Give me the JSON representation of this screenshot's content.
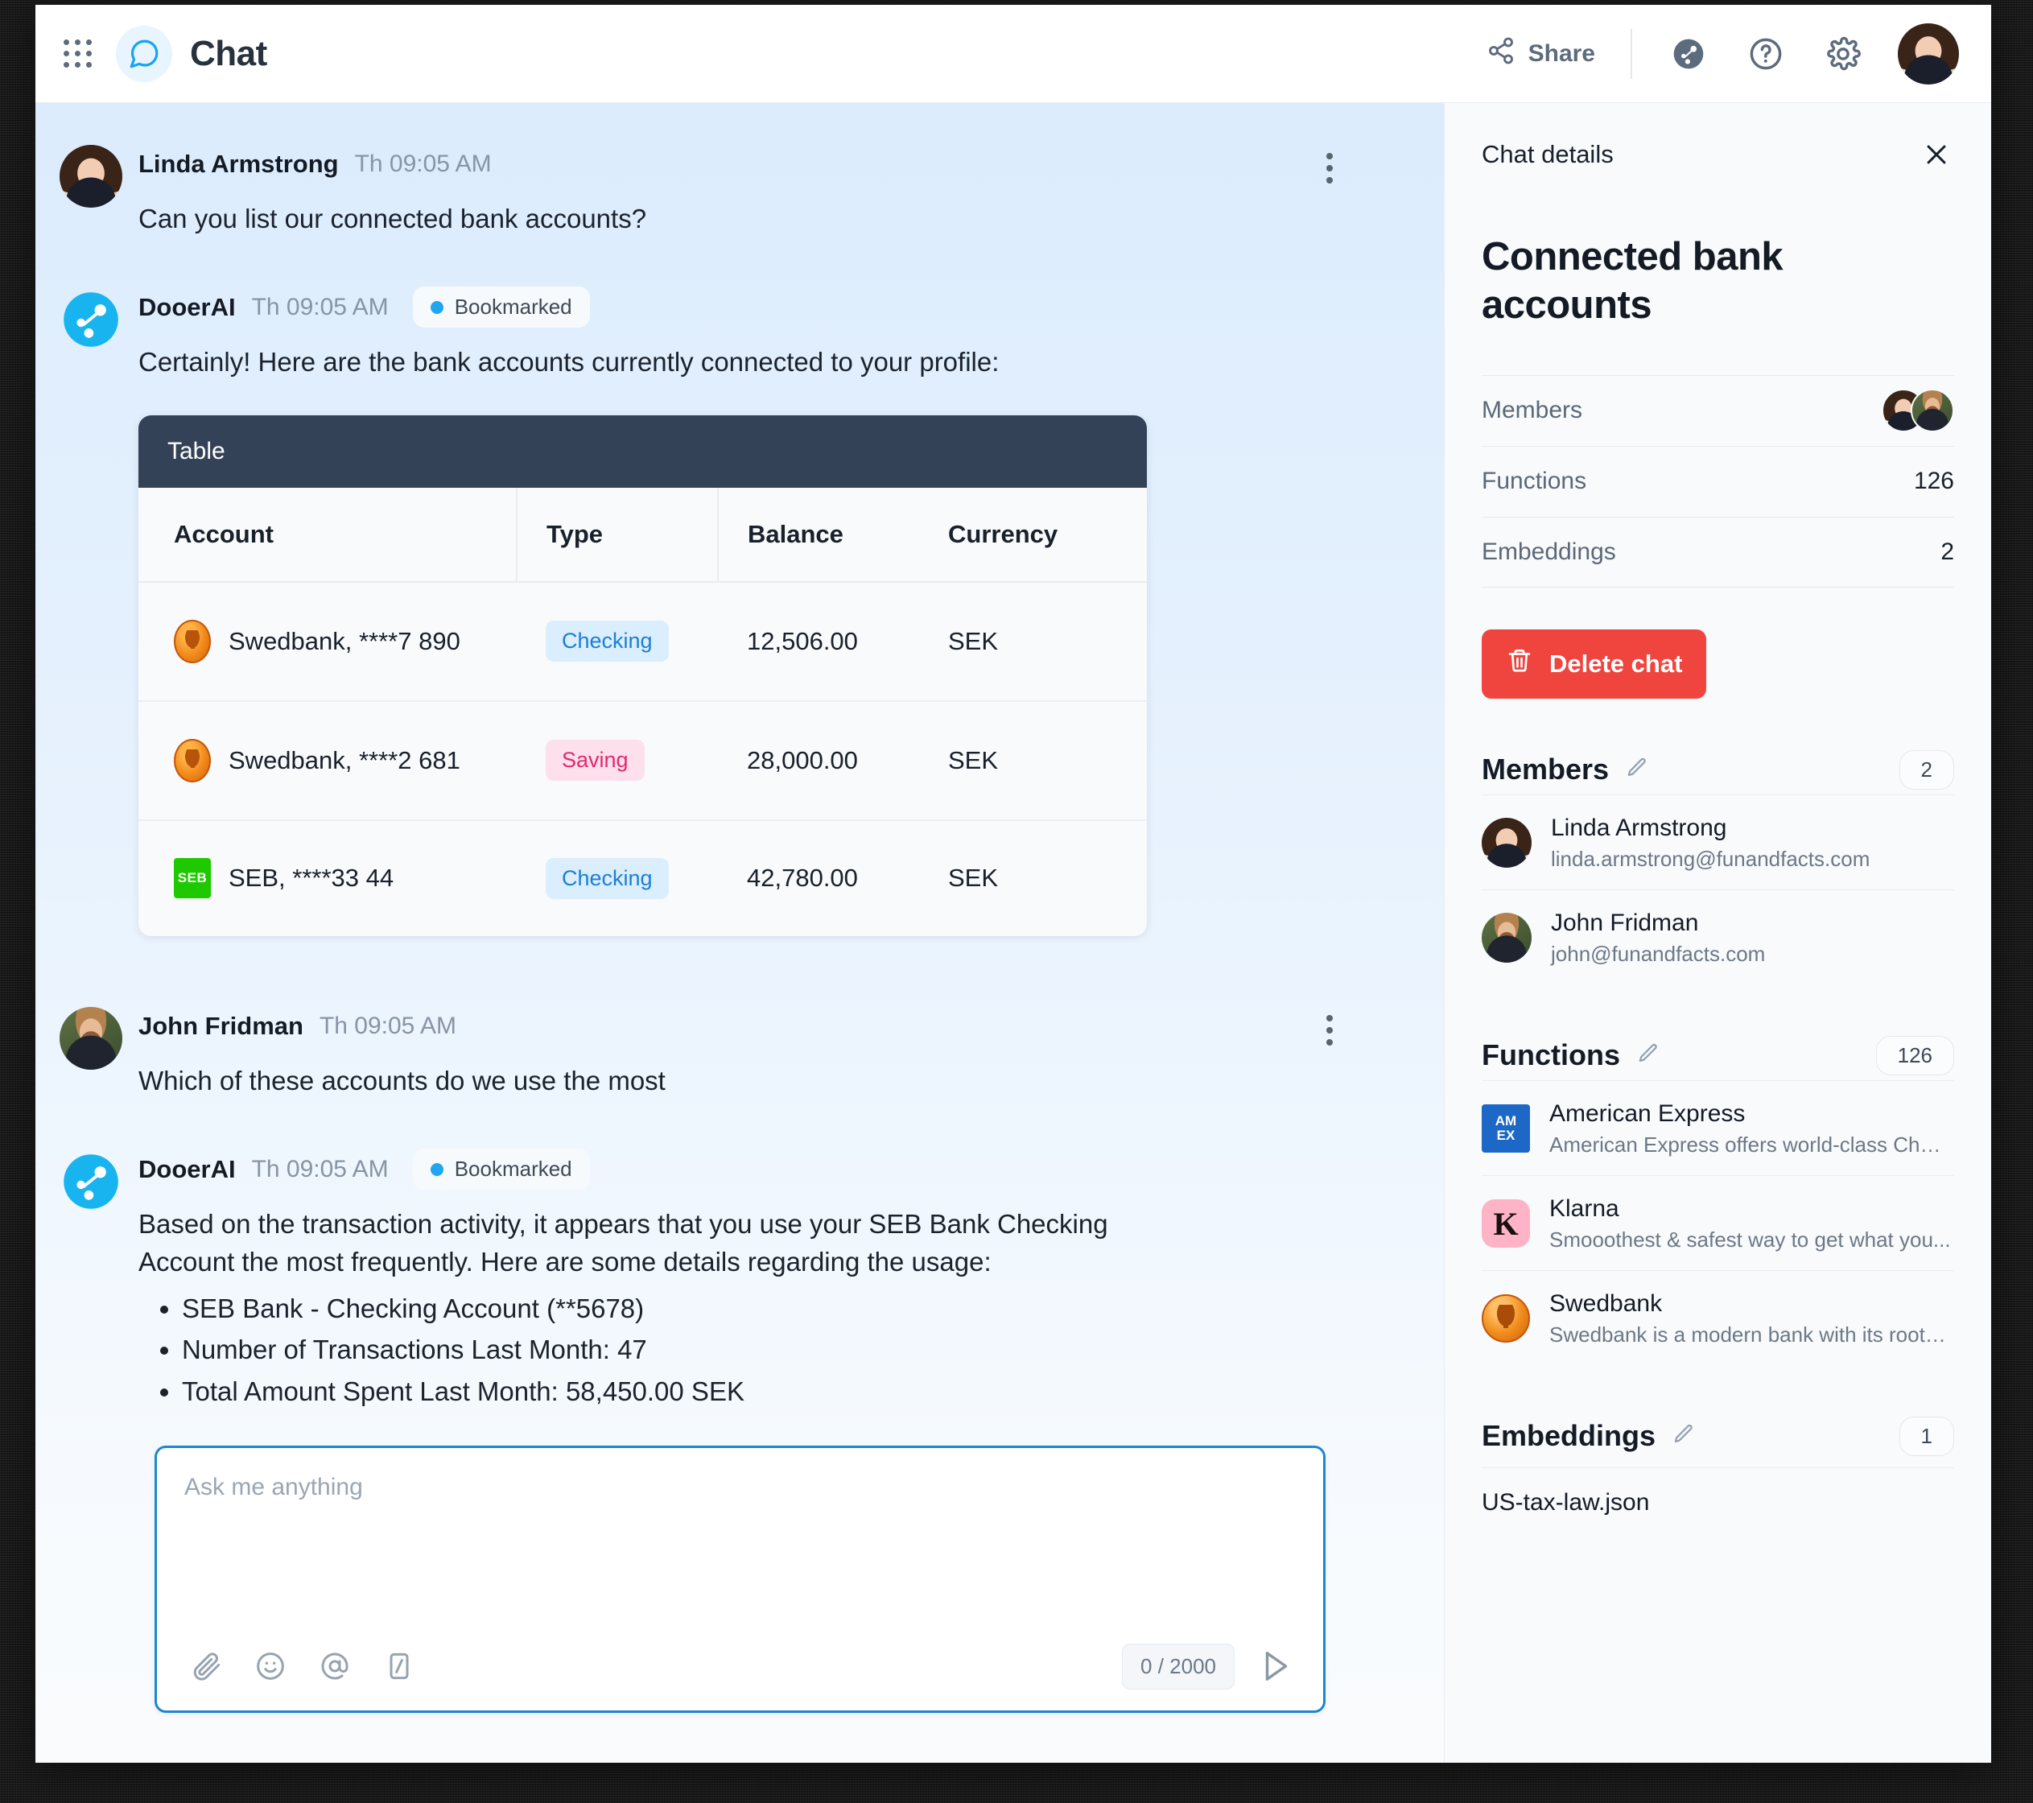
{
  "topbar": {
    "apps_icon": "grid-apps-icon",
    "logo_icon": "chat-bubble-icon",
    "title": "Chat",
    "share_label": "Share",
    "bot_icon": "dooer-ai-icon",
    "help_icon": "question-circle-icon",
    "settings_icon": "gear-icon",
    "avatar_icon": "user-avatar"
  },
  "messages": [
    {
      "sender": "Linda Armstrong",
      "time": "Th 09:05 AM",
      "text": "Can you list our connected bank accounts?",
      "bookmarked": false
    },
    {
      "sender": "DooerAI",
      "time": "Th 09:05 AM",
      "badge": "Bookmarked",
      "text": "Certainly! Here are the bank accounts currently connected to your profile:"
    },
    {
      "sender": "John Fridman",
      "time": "Th 09:05 AM",
      "text": "Which of these accounts do we use the most"
    },
    {
      "sender": "DooerAI",
      "time": "Th 09:05 AM",
      "badge": "Bookmarked",
      "text": "Based on the transaction activity, it appears that you use your SEB Bank Checking Account the most frequently. Here are some details regarding the usage:",
      "bullets": [
        "SEB Bank - Checking Account (**5678)",
        "Number of Transactions Last Month: 47",
        "Total Amount Spent Last Month: 58,450.00 SEK"
      ]
    }
  ],
  "table": {
    "caption": "Table",
    "headers": [
      "Account",
      "Type",
      "Balance",
      "Currency"
    ],
    "rows": [
      {
        "icon": "swedbank-logo-icon",
        "account": "Swedbank, ****7 890",
        "type": "Checking",
        "type_style": "checking",
        "balance": "12,506.00",
        "currency": "SEK"
      },
      {
        "icon": "swedbank-logo-icon",
        "account": "Swedbank, ****2 681",
        "type": "Saving",
        "type_style": "saving",
        "balance": "28,000.00",
        "currency": "SEK"
      },
      {
        "icon": "seb-logo-icon",
        "account": "SEB, ****33 44",
        "type": "Checking",
        "type_style": "checking",
        "balance": "42,780.00",
        "currency": "SEK"
      }
    ]
  },
  "composer": {
    "placeholder": "Ask me anything",
    "value": "",
    "counter": "0 / 2000",
    "attach_icon": "paperclip-icon",
    "emoji_icon": "emoji-smiley-icon",
    "mention_icon": "at-mention-icon",
    "slash_icon": "slash-command-icon",
    "send_icon": "send-arrow-icon"
  },
  "sidebar": {
    "panel_label": "Chat details",
    "close_icon": "close-icon",
    "title": "Connected bank accounts",
    "summary": [
      {
        "label": "Members",
        "value": ""
      },
      {
        "label": "Functions",
        "value": "126"
      },
      {
        "label": "Embeddings",
        "value": "2"
      }
    ],
    "delete_label": "Delete chat",
    "delete_icon": "trash-icon",
    "delete_color": "#f0453f",
    "members_section": {
      "title": "Members",
      "edit_icon": "pencil-icon",
      "count": "2",
      "items": [
        {
          "name": "Linda Armstrong",
          "email": "linda.armstrong@funandfacts.com",
          "avatar": "linda-avatar"
        },
        {
          "name": "John Fridman",
          "email": "john@funandfacts.com",
          "avatar": "john-avatar"
        }
      ]
    },
    "functions_section": {
      "title": "Functions",
      "edit_icon": "pencil-icon",
      "count": "126",
      "items": [
        {
          "name": "American Express",
          "desc": "American Express offers world-class Char...",
          "icon": "amex-logo-icon",
          "line1": "AM",
          "line2": "EX"
        },
        {
          "name": "Klarna",
          "desc": "Smooothest & safest way to get what you...",
          "icon": "klarna-logo-icon",
          "line1": "K"
        },
        {
          "name": "Swedbank",
          "desc": "Swedbank is a modern bank with its roots...",
          "icon": "swedbank-logo-icon"
        }
      ]
    },
    "embeddings_section": {
      "title": "Embeddings",
      "edit_icon": "pencil-icon",
      "count": "1",
      "items": [
        "US-tax-law.json"
      ]
    }
  }
}
